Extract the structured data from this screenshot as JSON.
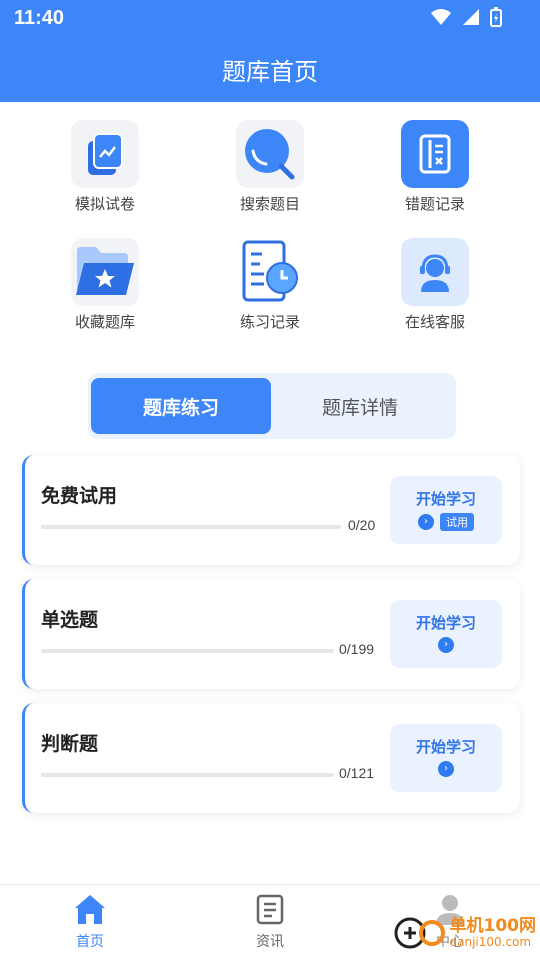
{
  "status_bar": {
    "time": "11:40"
  },
  "header": {
    "title": "题库首页"
  },
  "shortcuts": [
    {
      "label": "模拟试卷",
      "icon": "exam-paper-icon"
    },
    {
      "label": "搜索题目",
      "icon": "search-icon"
    },
    {
      "label": "错题记录",
      "icon": "wrong-record-icon"
    },
    {
      "label": "收藏题库",
      "icon": "folder-star-icon"
    },
    {
      "label": "练习记录",
      "icon": "practice-clock-icon"
    },
    {
      "label": "在线客服",
      "icon": "customer-service-icon"
    }
  ],
  "tabs": {
    "active": "题库练习",
    "idle": "题库详情"
  },
  "cards": [
    {
      "title": "免费试用",
      "progress": "0/20",
      "button": "开始学习",
      "badge": "试用"
    },
    {
      "title": "单选题",
      "progress": "0/199",
      "button": "开始学习"
    },
    {
      "title": "判断题",
      "progress": "0/121",
      "button": "开始学习"
    }
  ],
  "bottom_nav": {
    "home": "首页",
    "news": "资讯",
    "mine": "中心"
  },
  "watermark": {
    "text": "单机100网",
    "url": "danji100.com"
  },
  "colors": {
    "accent": "#3d86f7",
    "button_bg": "#e9f2fe",
    "button_text": "#3173e8"
  }
}
